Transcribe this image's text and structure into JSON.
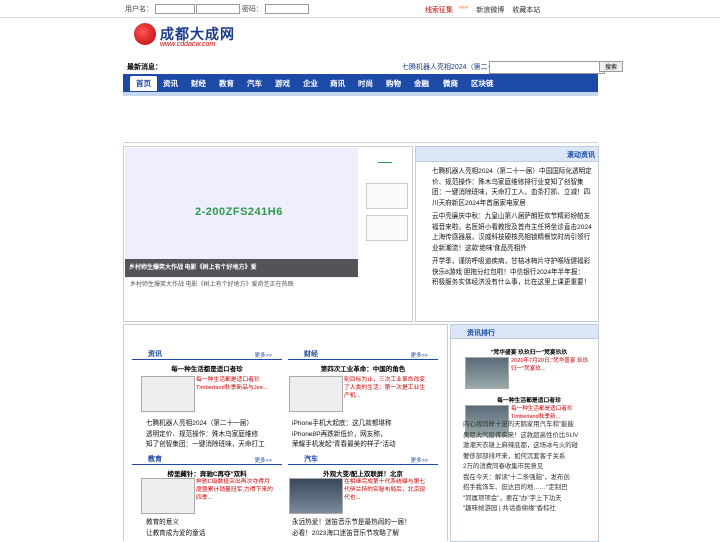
{
  "topbar": {
    "username_label": "用户名：",
    "password_label": "密码：",
    "links": [
      "线索征集",
      "新浪微博",
      "收藏本站"
    ],
    "hot_badge": "NEW"
  },
  "logo": {
    "name": "成都大成网",
    "url": "www.cddacw.com"
  },
  "latest": {
    "label": "最新消息：",
    "ticker": "七腾机器人亮相2024（第二十",
    "search_button": "搜索"
  },
  "nav": [
    "首页",
    "资讯",
    "财经",
    "教育",
    "汽车",
    "游戏",
    "企业",
    "商讯",
    "时尚",
    "购物",
    "金融",
    "微商",
    "区块链"
  ],
  "slide": {
    "image_text": "2-200ZFS241H6",
    "caption": "乡村师生爆笑大作战 电影《树上有个好地方》爱",
    "desc": "乡村师生爆笑大作战 电影《树上有个好地方》爱奇艺正在热映"
  },
  "scroll": {
    "title": "滚动资讯",
    "paragraphs": [
      "七腾机器人亮相2024（第二十一届）中国国际化透明定价、规范操作：殊木乌家庭维修排行业变知了创智集团：一键消除班味，天命打工人，血条打抓、立减！四川天府新区2024年首届家电家居",
      "云中亮廉庆中秋：九皇山第八届萨朗狂欢节精彩纷帕友福音来啦，名医妍小看教授及首舟主任将坐诊直击2024上海传感器展，汉威科技硬核亮相锁精餐饮时尚引领行业新潮流！这款'绝味'食品亮相外",
      "开学季，谨防呼吸道疾病，甘桔冰梅片守护喉咙健福彩快乐8游戏 胆拖分红包啦！中信银行2024年半年报： 积极服务实体经济没有什么事，比在这里上课更重要！"
    ]
  },
  "sections": [
    {
      "name": "资讯",
      "more": "更多>>",
      "headline": "每一种生活都是适口者珍",
      "pic_text": "每一种生活都是适口者珍 Timberland秋季新品与Jee...",
      "list": [
        "七腾机器人亮相2024（第二十一届）",
        "透明定价、规范操作：殊木乌家庭维修",
        "知了创智集团：一键消除班味，天命打工"
      ]
    },
    {
      "name": "财经",
      "more": "更多>>",
      "headline": "第四次工业革命：中国的角色",
      "pic_text": "别目标为止，三次工业革命改变了人类的生活：第一次是工业生产机...",
      "list": [
        "iPhone手机大起底：这几款都堪称",
        "iPhone8P再跌新低价，网友称，",
        "荣耀手机发起\"青春最美的样子\"活动"
      ]
    },
    {
      "name": "教育",
      "more": "更多>>",
      "headline": "榜里藏针：奔驰C再夺\"双料",
      "pic_text": "奔驰C级数投突出再次夺得月度暨累计销量冠军,力得下来的四季...",
      "list": [
        "教育的意义",
        "让教育成为爱的童话"
      ]
    },
    {
      "name": "汽车",
      "more": "更多>>",
      "headline": "外观大变/配上双联屏！北京",
      "pic_text": "在相继完成第十代系统曝与第七代伊兰特的实秘布局后，北京现代也...",
      "list": [
        "永远热爱！迷笛音乐节是最热闹的一届！",
        "必看！2023海口迷笛音乐节攻略了解"
      ]
    }
  ],
  "rank": {
    "title": "资讯排行",
    "items": [
      {
        "title": "\"梵华盛宴 玖玖归一\"梵宴玖玖",
        "text": "2020年7月20日,\"梵华盛宴 玖玖归一\"梵宴玖..."
      },
      {
        "title": "每一种生活都是适口者珍",
        "text": "每一种生活都是适口者珍 Timberland秋季新..."
      }
    ],
    "list": [
      "内心找同样十足的天鹅家用汽车和\"能能",
      "奥尼大气层传实来！这款超高性价比SUV",
      "激潮天衣雄上麻辣底都，这场冰与火的碰",
      "奢侈部部排坏来，如何沉套客子关系",
      "2万的消费同春收集市民意见",
      "我在今天：解读\"十二条强脑\"，发布创",
      "招手我饰车、逛达目的地……\"定制巴",
      "\"同属项项会\"，要在\"办\"字上下功夫",
      "\"趣味帧游园 | 共话香绵缘\"香棕社"
    ]
  }
}
